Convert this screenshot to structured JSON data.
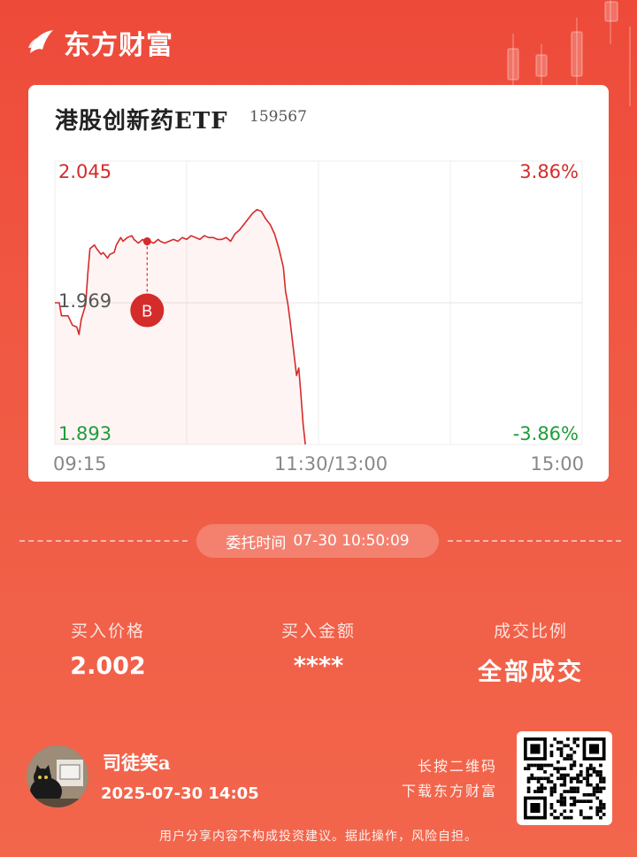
{
  "brand": {
    "name": "东方财富"
  },
  "stock": {
    "name": "港股创新药ETF",
    "code": "159567"
  },
  "chart_data": {
    "type": "line",
    "y_left_ticks": [
      "2.045",
      "1.969",
      "1.893"
    ],
    "y_right_ticks": [
      "3.86%",
      "-3.86%"
    ],
    "x_ticks": [
      "09:15",
      "11:30/13:00",
      "15:00"
    ],
    "ylim": [
      1.893,
      2.045
    ],
    "base_price": 1.969,
    "grid": true,
    "marker": {
      "label": "B",
      "price": 2.002
    },
    "series": [
      {
        "points": [
          [
            0,
            1.969
          ],
          [
            2,
            1.969
          ],
          [
            3,
            1.962
          ],
          [
            6,
            1.962
          ],
          [
            8,
            1.957
          ],
          [
            10,
            1.956
          ],
          [
            11,
            1.952
          ],
          [
            12,
            1.96
          ],
          [
            14,
            1.968
          ],
          [
            15,
            1.985
          ],
          [
            16,
            1.998
          ],
          [
            18,
            2.0
          ],
          [
            19,
            1.998
          ],
          [
            21,
            1.995
          ],
          [
            22,
            1.996
          ],
          [
            24,
            1.993
          ],
          [
            25,
            1.995
          ],
          [
            27,
            1.996
          ],
          [
            28,
            2.0
          ],
          [
            30,
            2.004
          ],
          [
            31,
            2.002
          ],
          [
            33,
            2.004
          ],
          [
            35,
            2.005
          ],
          [
            36,
            2.003
          ],
          [
            38,
            2.001
          ],
          [
            40,
            2.003
          ],
          [
            42,
            2.0
          ],
          [
            43,
            2.002
          ],
          [
            45,
            2.001
          ],
          [
            47,
            2.003
          ],
          [
            48,
            2.002
          ],
          [
            50,
            2.001
          ],
          [
            52,
            2.002
          ],
          [
            54,
            2.003
          ],
          [
            56,
            2.002
          ],
          [
            58,
            2.004
          ],
          [
            60,
            2.003
          ],
          [
            62,
            2.005
          ],
          [
            64,
            2.004
          ],
          [
            66,
            2.003
          ],
          [
            68,
            2.005
          ],
          [
            70,
            2.004
          ],
          [
            72,
            2.004
          ],
          [
            74,
            2.003
          ],
          [
            76,
            2.003
          ],
          [
            78,
            2.004
          ],
          [
            80,
            2.002
          ],
          [
            82,
            2.006
          ],
          [
            84,
            2.008
          ],
          [
            86,
            2.011
          ],
          [
            88,
            2.014
          ],
          [
            90,
            2.017
          ],
          [
            92,
            2.019
          ],
          [
            94,
            2.018
          ],
          [
            96,
            2.014
          ],
          [
            98,
            2.011
          ],
          [
            100,
            2.006
          ],
          [
            102,
            1.998
          ],
          [
            104,
            1.988
          ],
          [
            105,
            1.975
          ],
          [
            106,
            1.969
          ],
          [
            107,
            1.96
          ],
          [
            108,
            1.95
          ],
          [
            109,
            1.94
          ],
          [
            110,
            1.93
          ],
          [
            111,
            1.934
          ],
          [
            112,
            1.92
          ],
          [
            113,
            1.904
          ],
          [
            114,
            1.893
          ]
        ]
      }
    ]
  },
  "order": {
    "time_label": "委托时间",
    "time_value": "07-30 10:50:09"
  },
  "stats": [
    {
      "label": "买入价格",
      "value": "2.002"
    },
    {
      "label": "买入金额",
      "value": "****"
    },
    {
      "label": "成交比例",
      "value": "全部成交"
    }
  ],
  "user": {
    "name": "司徒笑a",
    "datetime": "2025-07-30 14:05"
  },
  "qr_tip": {
    "line1": "长按二维码",
    "line2": "下载东方财富"
  },
  "disclaimer": "用户分享内容不构成投资建议。据此操作，风险自担。",
  "colors": {
    "up": "#d42b2b",
    "down": "#1f9d3a",
    "accent": "#ee4a3a"
  }
}
